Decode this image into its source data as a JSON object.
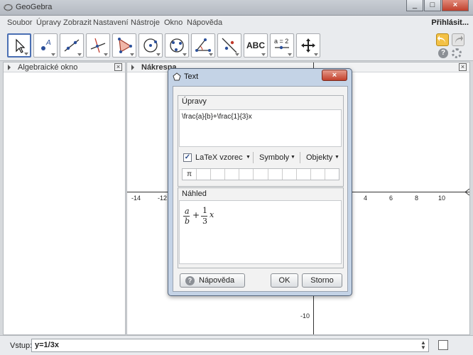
{
  "window": {
    "title": "GeoGebra",
    "minimize": "_",
    "maximize": "□",
    "close": "×"
  },
  "menu": {
    "items": [
      "Soubor",
      "Úpravy",
      "Zobrazit",
      "Nastavení",
      "Nástroje",
      "Okno",
      "Nápověda"
    ],
    "login": "Přihlásit..."
  },
  "toolbar": {
    "tools": [
      "move",
      "point",
      "line",
      "perpendicular",
      "polygon",
      "circle",
      "conic",
      "angle",
      "reflect",
      "text",
      "slider",
      "move-view"
    ],
    "text_tool_label": "ABC",
    "slider_tool_label": "a = 2",
    "accent": "#4a6fb3"
  },
  "algebra": {
    "title": "Algebraické okno"
  },
  "graphics": {
    "title": "Nákresna",
    "x_ticks": [
      "-14",
      "-12",
      "4",
      "6",
      "8",
      "10"
    ],
    "y_ticks": [
      "-10"
    ]
  },
  "input": {
    "label": "Vstup:",
    "value": "y=1/3x"
  },
  "dialog": {
    "title": "Text",
    "edit_section": "Úpravy",
    "latex_text": "\\frac{a}{b}+\\frac{1}{3}x",
    "latex_checkbox": "LaTeX vzorec",
    "symbols_menu": "Symboly",
    "objects_menu": "Objekty",
    "symbols": [
      "π",
      "",
      "",
      "",
      "",
      "",
      "",
      "",
      "",
      "",
      ""
    ],
    "preview_section": "Náhled",
    "preview": {
      "num1": "a",
      "den1": "b",
      "plus": "+",
      "num2": "1",
      "den2": "3",
      "var": "x"
    },
    "help_button": "Nápověda",
    "ok_button": "OK",
    "cancel_button": "Storno"
  }
}
